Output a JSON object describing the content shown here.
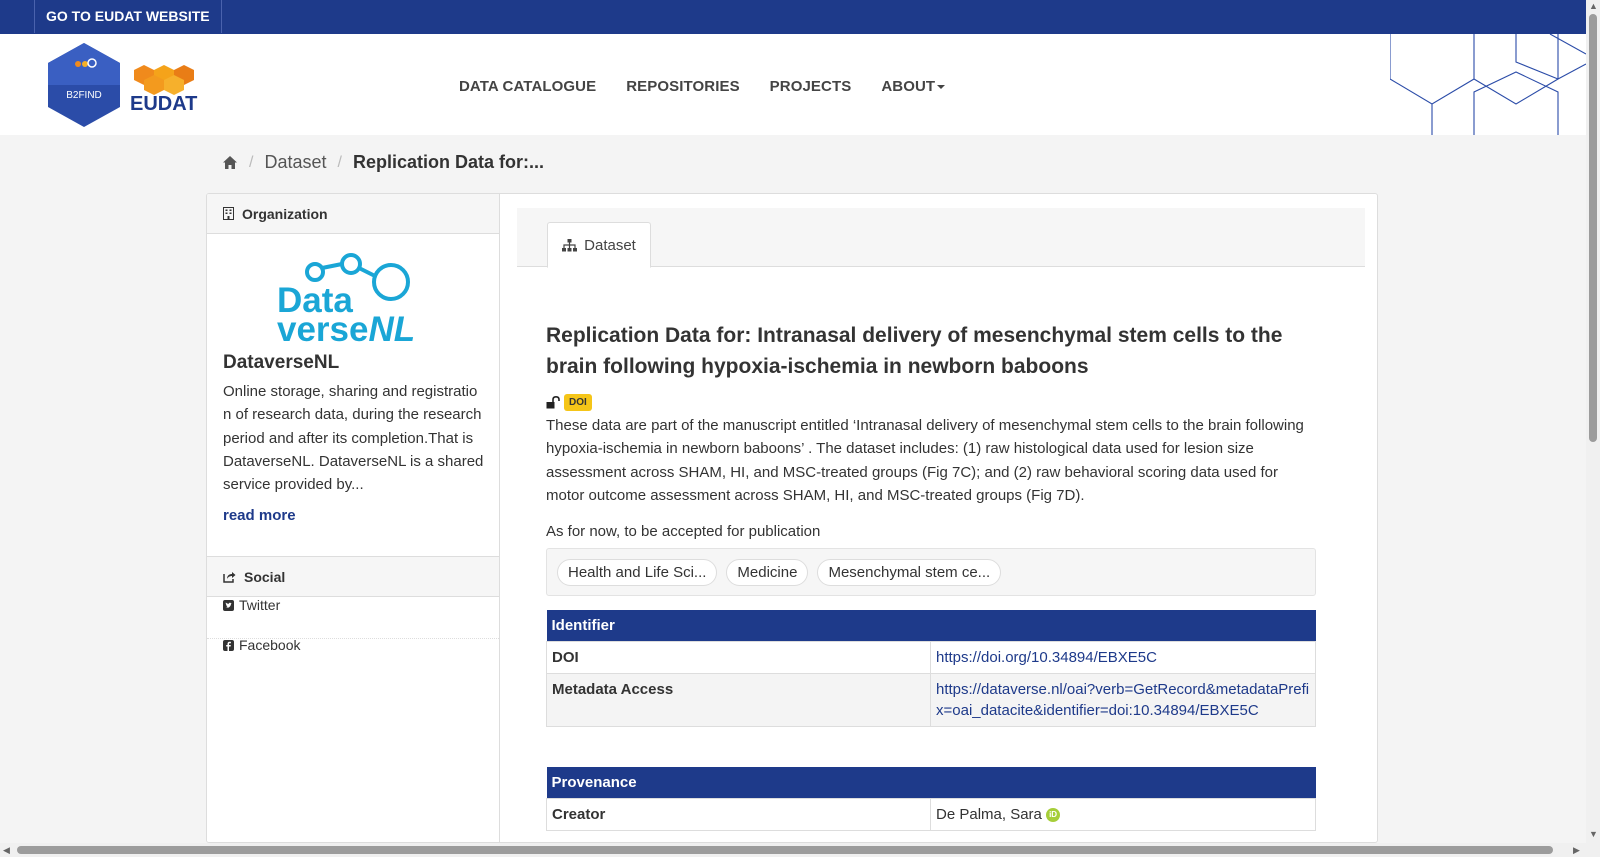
{
  "topbar": {
    "eudat_link": "GO TO EUDAT WEBSITE"
  },
  "header": {
    "logo_text": "B2FIND",
    "brand": "EUDAT",
    "nav": [
      "DATA CATALOGUE",
      "REPOSITORIES",
      "PROJECTS",
      "ABOUT"
    ]
  },
  "breadcrumb": {
    "items": [
      "Dataset",
      "Replication Data for:..."
    ]
  },
  "sidebar": {
    "org_heading": "Organization",
    "org_logo_line1": "Data",
    "org_logo_line2_a": "verse",
    "org_logo_line2_b": "NL",
    "org_name": "DataverseNL",
    "org_desc": "Online storage, sharing and registration of research data, during the research period and after its completion.That is DataverseNL. DataverseNL is a shared service provided by...",
    "read_more": "read more",
    "social_heading": "Social",
    "twitter": "Twitter",
    "facebook": "Facebook"
  },
  "main": {
    "tab_label": "Dataset",
    "title": "Replication Data for: Intranasal delivery of mesenchymal stem cells to the brain following hypoxia-ischemia in newborn baboons",
    "doi_badge": "DOI",
    "description": "These data are part of the manuscript entitled ‘Intranasal delivery of mesenchymal stem cells to the brain following hypoxia-ischemia in newborn baboons’ . The dataset includes: (1) raw histological data used for lesion size assessment across SHAM, HI, and MSC-treated groups (Fig 7C); and (2) raw behavioral scoring data used for motor outcome assessment across SHAM, HI, and MSC-treated groups (Fig 7D).",
    "note": "As for now, to be accepted for publication",
    "tags": [
      "Health and Life Sci...",
      "Medicine",
      "Mesenchymal stem ce..."
    ],
    "identifier": {
      "heading": "Identifier",
      "doi_label": "DOI",
      "doi_value": "https://doi.org/10.34894/EBXE5C",
      "meta_label": "Metadata Access",
      "meta_value": "https://dataverse.nl/oai?verb=GetRecord&metadataPrefix=oai_datacite&identifier=doi:10.34894/EBXE5C"
    },
    "provenance": {
      "heading": "Provenance",
      "creator_label": "Creator",
      "creator_value": "De Palma, Sara",
      "orcid_mark": "iD"
    }
  },
  "colors": {
    "brand_blue": "#1e3a8a",
    "doi_yellow": "#f5c518",
    "orcid_green": "#a6ce39",
    "logo_cyan": "#1aa6d6"
  }
}
